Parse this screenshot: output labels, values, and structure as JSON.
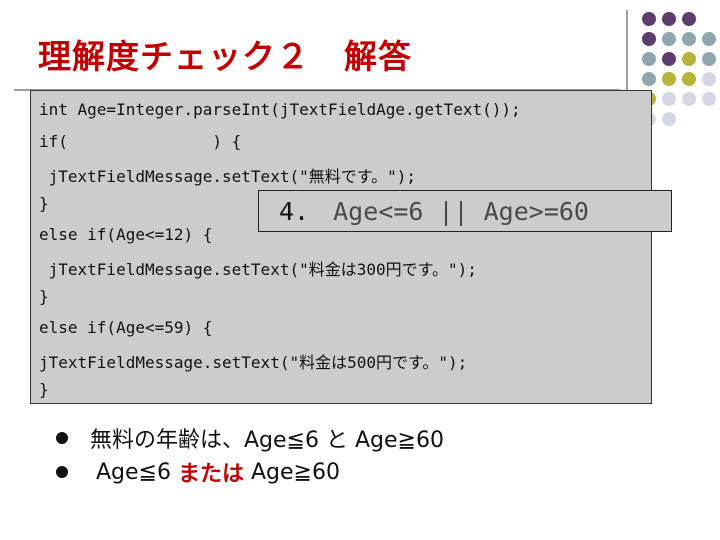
{
  "slide": {
    "title": "理解度チェック２　解答",
    "code_lines": [
      "int Age=Integer.parseInt(jTextFieldAge.getText());",
      "if(               ) {",
      " jTextFieldMessage.setText(\"無料です。\");",
      "}",
      "else if(Age<=12) {",
      " jTextFieldMessage.setText(\"料金は300円です。\");",
      "}",
      "else if(Age<=59) {",
      "jTextFieldMessage.setText(\"料金は500円です。\");",
      "}"
    ],
    "answer": {
      "number": "4.",
      "expression": "Age<=6 || Age>=60"
    },
    "bullets": [
      {
        "text": "無料の年齢は、Age≦6 と Age≧60"
      },
      {
        "pre": "Age≦6 ",
        "emph": "または",
        "post": " Age≧60"
      }
    ],
    "colors": {
      "title": "#c00000",
      "emphasis": "#c00000",
      "code_bg": "#cccccc",
      "dot_purple": "#5b3d6e",
      "dot_gray": "#8fa6ad",
      "dot_olive": "#b7b43a",
      "dot_light": "#d5d7e3"
    }
  }
}
